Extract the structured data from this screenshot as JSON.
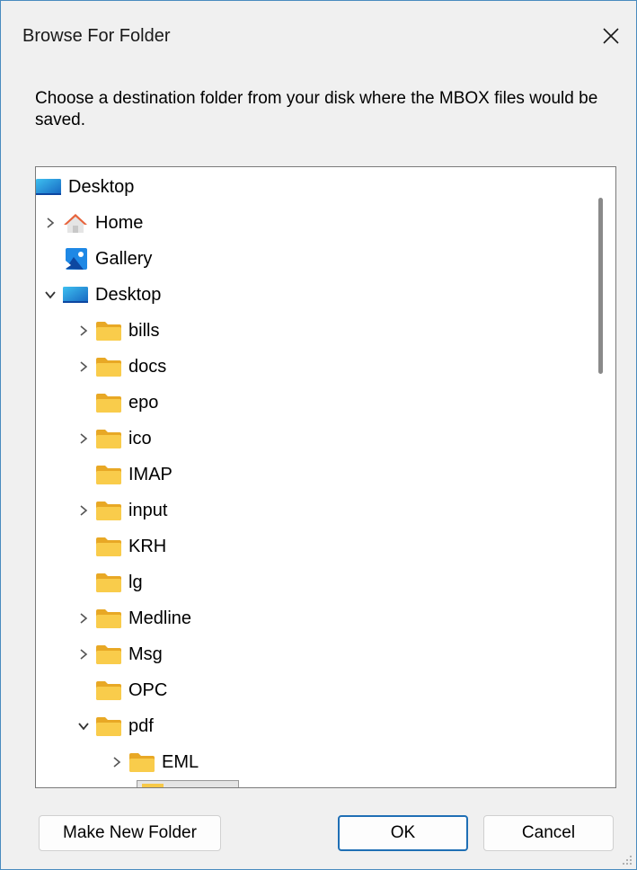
{
  "window": {
    "title": "Browse For Folder",
    "close_icon": "close-icon"
  },
  "prompt": "Choose a destination folder from your disk where the MBOX files would be saved.",
  "tree": {
    "items": [
      {
        "label": "Desktop",
        "icon": "desktop-icon",
        "level": 0,
        "chevron": "none"
      },
      {
        "label": "Home",
        "icon": "home-icon",
        "level": 1,
        "chevron": "right"
      },
      {
        "label": "Gallery",
        "icon": "gallery-icon",
        "level": 1,
        "chevron": "none"
      },
      {
        "label": "Desktop",
        "icon": "desktop-icon",
        "level": 1,
        "chevron": "down"
      },
      {
        "label": "bills",
        "icon": "folder-icon",
        "level": 2,
        "chevron": "right"
      },
      {
        "label": "docs",
        "icon": "folder-icon",
        "level": 2,
        "chevron": "right"
      },
      {
        "label": "epo",
        "icon": "folder-icon",
        "level": 2,
        "chevron": "none"
      },
      {
        "label": "ico",
        "icon": "folder-icon",
        "level": 2,
        "chevron": "right"
      },
      {
        "label": "IMAP",
        "icon": "folder-icon",
        "level": 2,
        "chevron": "none"
      },
      {
        "label": "input",
        "icon": "folder-icon",
        "level": 2,
        "chevron": "right"
      },
      {
        "label": "KRH",
        "icon": "folder-icon",
        "level": 2,
        "chevron": "none"
      },
      {
        "label": "lg",
        "icon": "folder-icon",
        "level": 2,
        "chevron": "none"
      },
      {
        "label": "Medline",
        "icon": "folder-icon",
        "level": 2,
        "chevron": "right"
      },
      {
        "label": "Msg",
        "icon": "folder-icon",
        "level": 2,
        "chevron": "right"
      },
      {
        "label": "OPC",
        "icon": "folder-icon",
        "level": 2,
        "chevron": "none"
      },
      {
        "label": "pdf",
        "icon": "folder-icon",
        "level": 2,
        "chevron": "down"
      },
      {
        "label": "EML",
        "icon": "folder-icon",
        "level": 3,
        "chevron": "right"
      }
    ]
  },
  "buttons": {
    "make_new_folder": "Make New Folder",
    "ok": "OK",
    "cancel": "Cancel"
  },
  "colors": {
    "folder": "#f7c948",
    "accent": "#1f6fb5",
    "border": "#4a8bbf"
  }
}
